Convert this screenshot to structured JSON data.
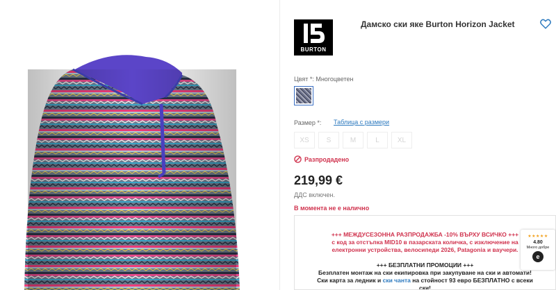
{
  "product": {
    "title": "Дамско ски яке Burton Horizon Jacket",
    "brand_logo_text": "BURTON",
    "color_label": "Цвят *: Многоцветен",
    "size_label": "Размер *:",
    "size_chart_link": "Таблица с размери",
    "sizes": [
      "XS",
      "S",
      "M",
      "L",
      "XL"
    ],
    "soldout_label": "Разпродадено",
    "price": "219,99 €",
    "vat_note": "ДДС включен.",
    "availability": "В момента не е налично"
  },
  "promo": {
    "line1": "+++ МЕЖДУСЕЗОННА РАЗПРОДАЖБА -10% ВЪРХУ ВСИЧКО +++",
    "line2": "с код за отстъпка MID10 в пазарската количка, с изключение на",
    "line3": "електронни устройства, велосипеди 2026, Patagonia и ваучери.",
    "line4": "+++ БЕЗПЛАТНИ ПРОМОЦИИ +++",
    "line5": "Безплатен монтаж на ски екипировка при закупуване на ски и автомати!",
    "line6a": "Ски карта за ледник и",
    "line6_link": "ски чанта",
    "line6b": "на стойност 93 евро БЕЗПЛАТНО с всеки",
    "line7": "ски!"
  },
  "badge": {
    "stars": "★★★★★",
    "score": "4.80",
    "text": "Много добре",
    "logo": "e"
  },
  "icons": {
    "favorite": "heart-icon",
    "soldout": "no-entry-icon"
  },
  "colors": {
    "accent_blue": "#2d7abf",
    "alert_red": "#d0334e"
  }
}
